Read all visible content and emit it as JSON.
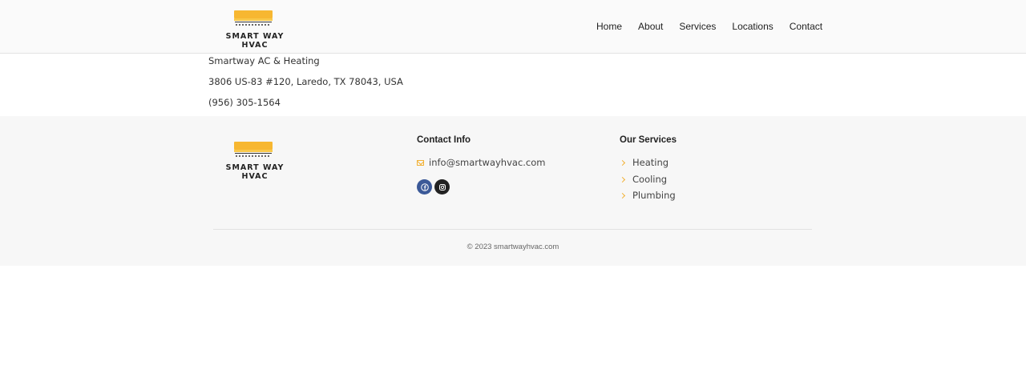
{
  "header": {
    "logo_text": "SMART WAY HVAC",
    "nav": [
      {
        "label": "Home"
      },
      {
        "label": "About"
      },
      {
        "label": "Services"
      },
      {
        "label": "Locations"
      },
      {
        "label": "Contact"
      }
    ]
  },
  "info": {
    "business_name": "Smartway AC & Heating",
    "address": "3806 US-83 #120, Laredo, TX 78043, USA",
    "phone": "(956) 305-1564"
  },
  "footer": {
    "logo_text": "SMART WAY HVAC",
    "contact_title": "Contact Info",
    "email": "info@smartwayhvac.com",
    "social": [
      {
        "icon": "facebook-icon"
      },
      {
        "icon": "instagram-icon"
      }
    ],
    "services_title": "Our Services",
    "services": [
      {
        "label": "Heating"
      },
      {
        "label": "Cooling"
      },
      {
        "label": "Plumbing"
      }
    ],
    "copyright": "© 2023 smartwayhvac.com"
  },
  "colors": {
    "accent": "#f2b134",
    "facebook": "#3b5998",
    "instagram": "#222222"
  }
}
